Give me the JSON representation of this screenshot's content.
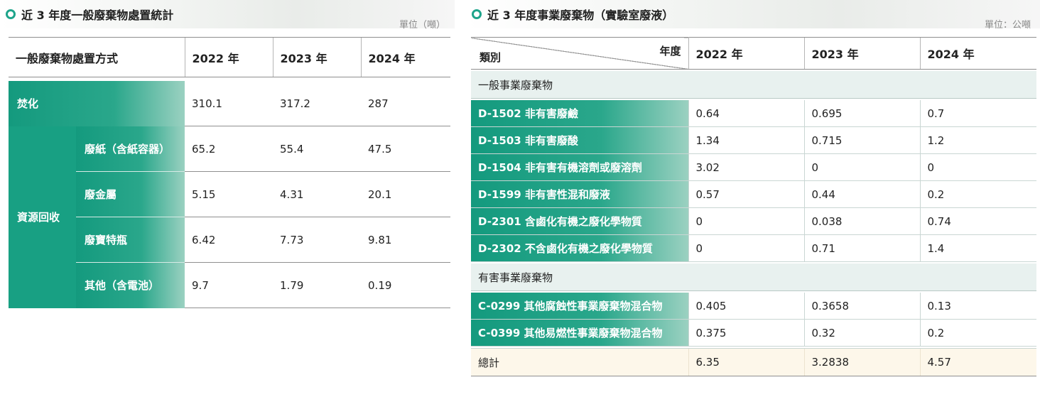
{
  "left": {
    "title": "近 3 年度一般廢棄物處置統計",
    "unit": "單位（噸）",
    "header": {
      "method": "一般廢棄物處置方式",
      "years": [
        "2022 年",
        "2023 年",
        "2024 年"
      ]
    },
    "incineration": {
      "label": "焚化",
      "values": [
        "310.1",
        "317.2",
        "287"
      ]
    },
    "recycling": {
      "label": "資源回收",
      "rows": [
        {
          "label": "廢紙（含紙容器）",
          "values": [
            "65.2",
            "55.4",
            "47.5"
          ]
        },
        {
          "label": "廢金屬",
          "values": [
            "5.15",
            "4.31",
            "20.1"
          ]
        },
        {
          "label": "廢寶特瓶",
          "values": [
            "6.42",
            "7.73",
            "9.81"
          ]
        },
        {
          "label": "其他（含電池）",
          "values": [
            "9.7",
            "1.79",
            "0.19"
          ]
        }
      ]
    }
  },
  "right": {
    "title": "近 3 年度事業廢棄物（實驗室廢液）",
    "unit": "單位：公噸",
    "header": {
      "category": "類別",
      "year": "年度",
      "years": [
        "2022 年",
        "2023 年",
        "2024 年"
      ]
    },
    "general": {
      "label": "一般事業廢棄物",
      "rows": [
        {
          "label": "D-1502 非有害廢鹼",
          "values": [
            "0.64",
            "0.695",
            "0.7"
          ]
        },
        {
          "label": "D-1503 非有害廢酸",
          "values": [
            "1.34",
            "0.715",
            "1.2"
          ]
        },
        {
          "label": "D-1504 非有害有機溶劑或廢溶劑",
          "values": [
            "3.02",
            "0",
            "0"
          ]
        },
        {
          "label": "D-1599 非有害性混和廢液",
          "values": [
            "0.57",
            "0.44",
            "0.2"
          ]
        },
        {
          "label": "D-2301 含鹵化有機之廢化學物質",
          "values": [
            "0",
            "0.038",
            "0.74"
          ]
        },
        {
          "label": "D-2302 不含鹵化有機之廢化學物質",
          "values": [
            "0",
            "0.71",
            "1.4"
          ]
        }
      ]
    },
    "hazardous": {
      "label": "有害事業廢棄物",
      "rows": [
        {
          "label": "C-0299 其他腐蝕性事業廢棄物混合物",
          "values": [
            "0.405",
            "0.3658",
            "0.13"
          ]
        },
        {
          "label": "C-0399 其他易燃性事業廢棄物混合物",
          "values": [
            "0.375",
            "0.32",
            "0.2"
          ]
        }
      ]
    },
    "total": {
      "label": "總計",
      "values": [
        "6.35",
        "3.2838",
        "4.57"
      ]
    }
  }
}
